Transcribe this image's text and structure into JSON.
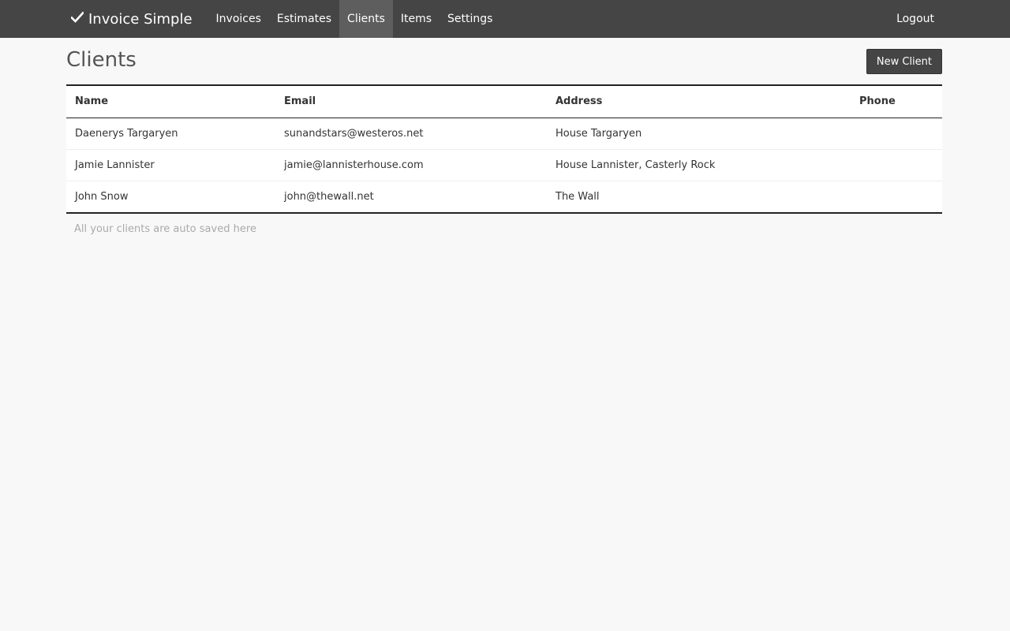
{
  "app": {
    "brand": "Invoice Simple"
  },
  "nav": {
    "items": [
      {
        "label": "Invoices",
        "active": false
      },
      {
        "label": "Estimates",
        "active": false
      },
      {
        "label": "Clients",
        "active": true
      },
      {
        "label": "Items",
        "active": false
      },
      {
        "label": "Settings",
        "active": false
      }
    ],
    "logout_label": "Logout"
  },
  "page": {
    "title": "Clients",
    "new_button_label": "New Client",
    "footnote": "All your clients are auto saved here"
  },
  "table": {
    "columns": [
      "Name",
      "Email",
      "Address",
      "Phone"
    ],
    "rows": [
      {
        "name": "Daenerys Targaryen",
        "email": "sunandstars@westeros.net",
        "address": "House Targaryen",
        "phone": ""
      },
      {
        "name": "Jamie Lannister",
        "email": "jamie@lannisterhouse.com",
        "address": "House Lannister, Casterly Rock",
        "phone": ""
      },
      {
        "name": "John Snow",
        "email": "john@thewall.net",
        "address": "The Wall",
        "phone": ""
      }
    ]
  },
  "colors": {
    "navbar": "#454545",
    "nav_active": "#5e5e5e",
    "background": "#f8f8f8"
  }
}
